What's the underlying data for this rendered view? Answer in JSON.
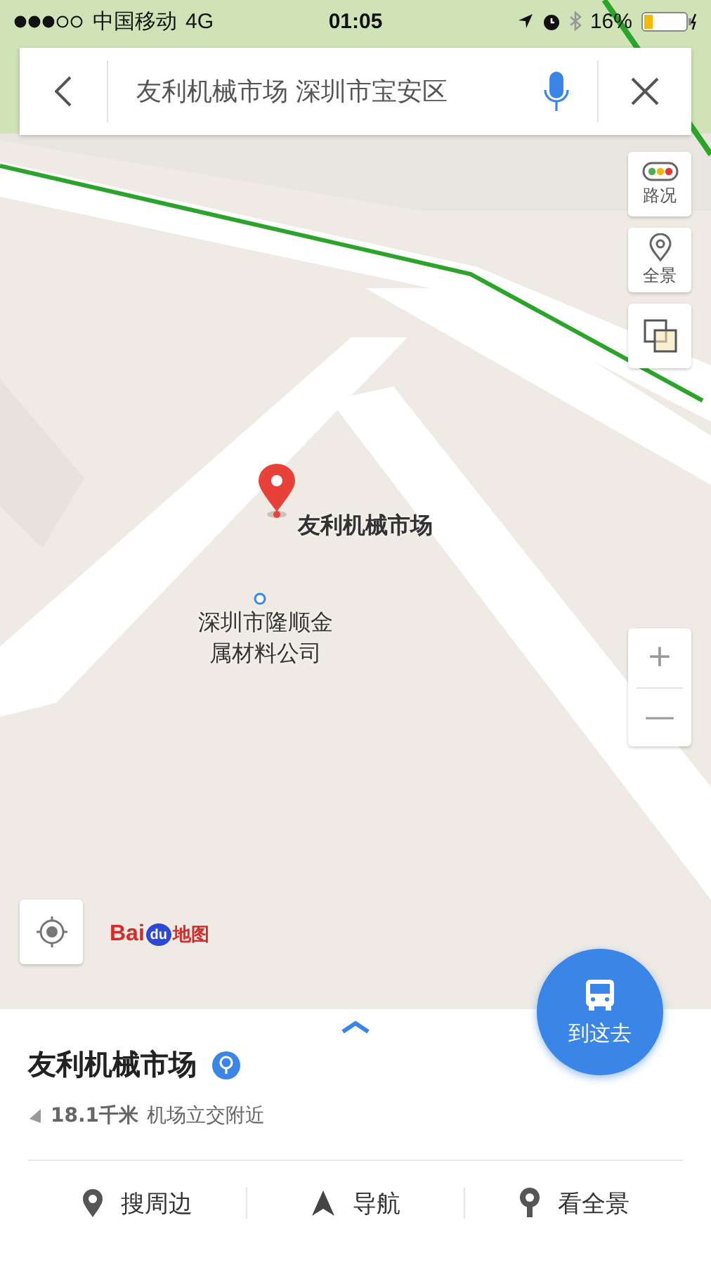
{
  "status_bar": {
    "carrier": "中国移动",
    "network": "4G",
    "time": "01:05",
    "battery": "16%"
  },
  "search": {
    "value": "友利机械市场 深圳市宝安区"
  },
  "map_controls": [
    {
      "kind": "traffic",
      "label": "路况"
    },
    {
      "kind": "panorama",
      "label": "全景"
    },
    {
      "kind": "layers"
    }
  ],
  "zoom": {
    "in": "+",
    "out": "—"
  },
  "map_labels": [
    {
      "kind": "pin",
      "text": "友利机械市场"
    },
    {
      "kind": "poi",
      "text": "深圳市隆顺金属材料公司"
    }
  ],
  "logo": {
    "prefix": "Bai",
    "badge": "du",
    "suffix": "地图"
  },
  "go_button": {
    "label": "到这去"
  },
  "place": {
    "name": "友利机械市场",
    "distance": "18.1千米",
    "area": "机场立交附近"
  },
  "actions": [
    {
      "kind": "nearby",
      "label": "搜周边"
    },
    {
      "kind": "navigate",
      "label": "导航"
    },
    {
      "kind": "panorama",
      "label": "看全景"
    }
  ]
}
